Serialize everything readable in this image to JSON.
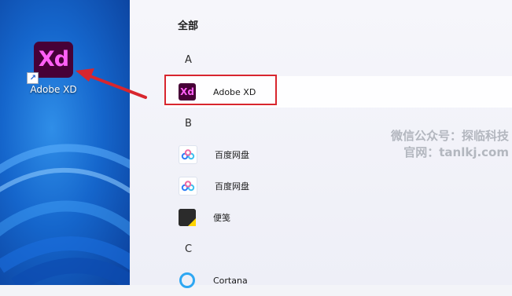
{
  "desktop": {
    "icon_label": "Adobe XD",
    "icon_glyph": "Xd",
    "icon_name": "adobe-xd-icon"
  },
  "start_menu": {
    "section_title": "全部",
    "groups": [
      {
        "letter": "A",
        "apps": [
          {
            "name": "Adobe XD",
            "icon": "adobe-xd-icon",
            "glyph": "Xd",
            "highlighted": true
          }
        ]
      },
      {
        "letter": "B",
        "apps": [
          {
            "name": "百度网盘",
            "icon": "baidu-netdisk-icon",
            "highlighted": false
          },
          {
            "name": "百度网盘",
            "icon": "baidu-netdisk-icon",
            "highlighted": false
          },
          {
            "name": "便笺",
            "icon": "sticky-notes-icon",
            "highlighted": false
          }
        ]
      },
      {
        "letter": "C",
        "apps": [
          {
            "name": "Cortana",
            "icon": "cortana-icon",
            "highlighted": false
          }
        ]
      }
    ]
  },
  "watermark": {
    "line1": "微信公众号：探临科技",
    "line2": "官网：tanlkj.com"
  },
  "colors": {
    "xd_background": "#470137",
    "xd_magenta": "#ff61f6",
    "annotation_red": "#d8262e"
  }
}
